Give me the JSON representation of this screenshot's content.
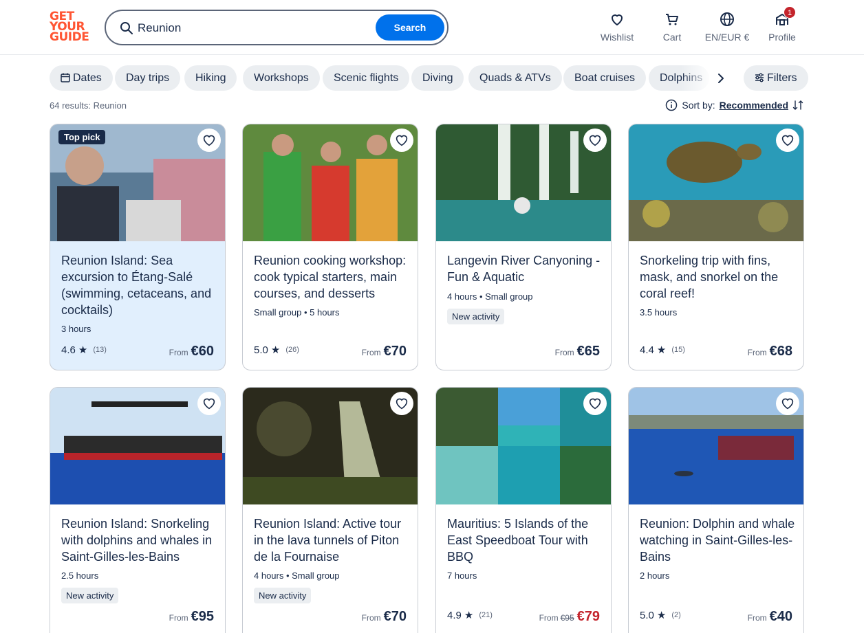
{
  "header": {
    "logo": [
      "GET",
      "YOUR",
      "GUIDE"
    ],
    "search_value": "Reunion",
    "search_button": "Search",
    "nav": [
      {
        "label": "Wishlist",
        "icon": "heart-icon"
      },
      {
        "label": "Cart",
        "icon": "cart-icon"
      },
      {
        "label": "EN/EUR €",
        "icon": "globe-icon"
      },
      {
        "label": "Profile",
        "icon": "profile-icon",
        "badge": "1"
      }
    ]
  },
  "chips": [
    "Dates",
    "Day trips",
    "Hiking",
    "Workshops",
    "Scenic flights",
    "Diving",
    "Quads & ATVs",
    "Boat cruises",
    "Dolphins"
  ],
  "filters_label": "Filters",
  "results_text": "64 results: Reunion",
  "sort": {
    "label": "Sort by:",
    "value": "Recommended"
  },
  "cards": [
    {
      "badge": "Top pick",
      "title": "Reunion Island: Sea excursion to Étang-Salé (swimming, cetaceans, and cocktails)",
      "meta": "3 hours",
      "rating": "4.6",
      "reviews": "(13)",
      "from": "From",
      "price": "€60"
    },
    {
      "title": "Reunion cooking workshop: cook typical starters, main courses, and desserts",
      "meta": "Small group • 5 hours",
      "rating": "5.0",
      "reviews": "(26)",
      "from": "From",
      "price": "€70"
    },
    {
      "title": "Langevin River Canyoning - Fun & Aquatic",
      "meta": "4 hours • Small group",
      "new": "New activity",
      "from": "From",
      "price": "€65"
    },
    {
      "title": "Snorkeling trip with fins, mask, and snorkel on the coral reef!",
      "meta": "3.5 hours",
      "rating": "4.4",
      "reviews": "(15)",
      "from": "From",
      "price": "€68"
    },
    {
      "title": "Reunion Island: Snorkeling with dolphins and whales in Saint-Gilles-les-Bains",
      "meta": "2.5 hours",
      "new": "New activity",
      "from": "From",
      "price": "€95"
    },
    {
      "title": "Reunion Island: Active tour in the lava tunnels of Piton de la Fournaise",
      "meta": "4 hours • Small group",
      "new": "New activity",
      "from": "From",
      "price": "€70"
    },
    {
      "title": "Mauritius: 5 Islands of the East Speedboat Tour with BBQ",
      "meta": "7 hours",
      "rating": "4.9",
      "reviews": "(21)",
      "from": "From",
      "old_price": "€95",
      "price": "€79"
    },
    {
      "title": "Reunion: Dolphin and whale watching in Saint-Gilles-les-Bains",
      "meta": "2 hours",
      "rating": "5.0",
      "reviews": "(2)",
      "from": "From",
      "price": "€40"
    }
  ],
  "colors": {
    "brand": "#ff5533",
    "accent": "#0071eb",
    "text": "#1a2b49",
    "sale": "#c4242c"
  }
}
